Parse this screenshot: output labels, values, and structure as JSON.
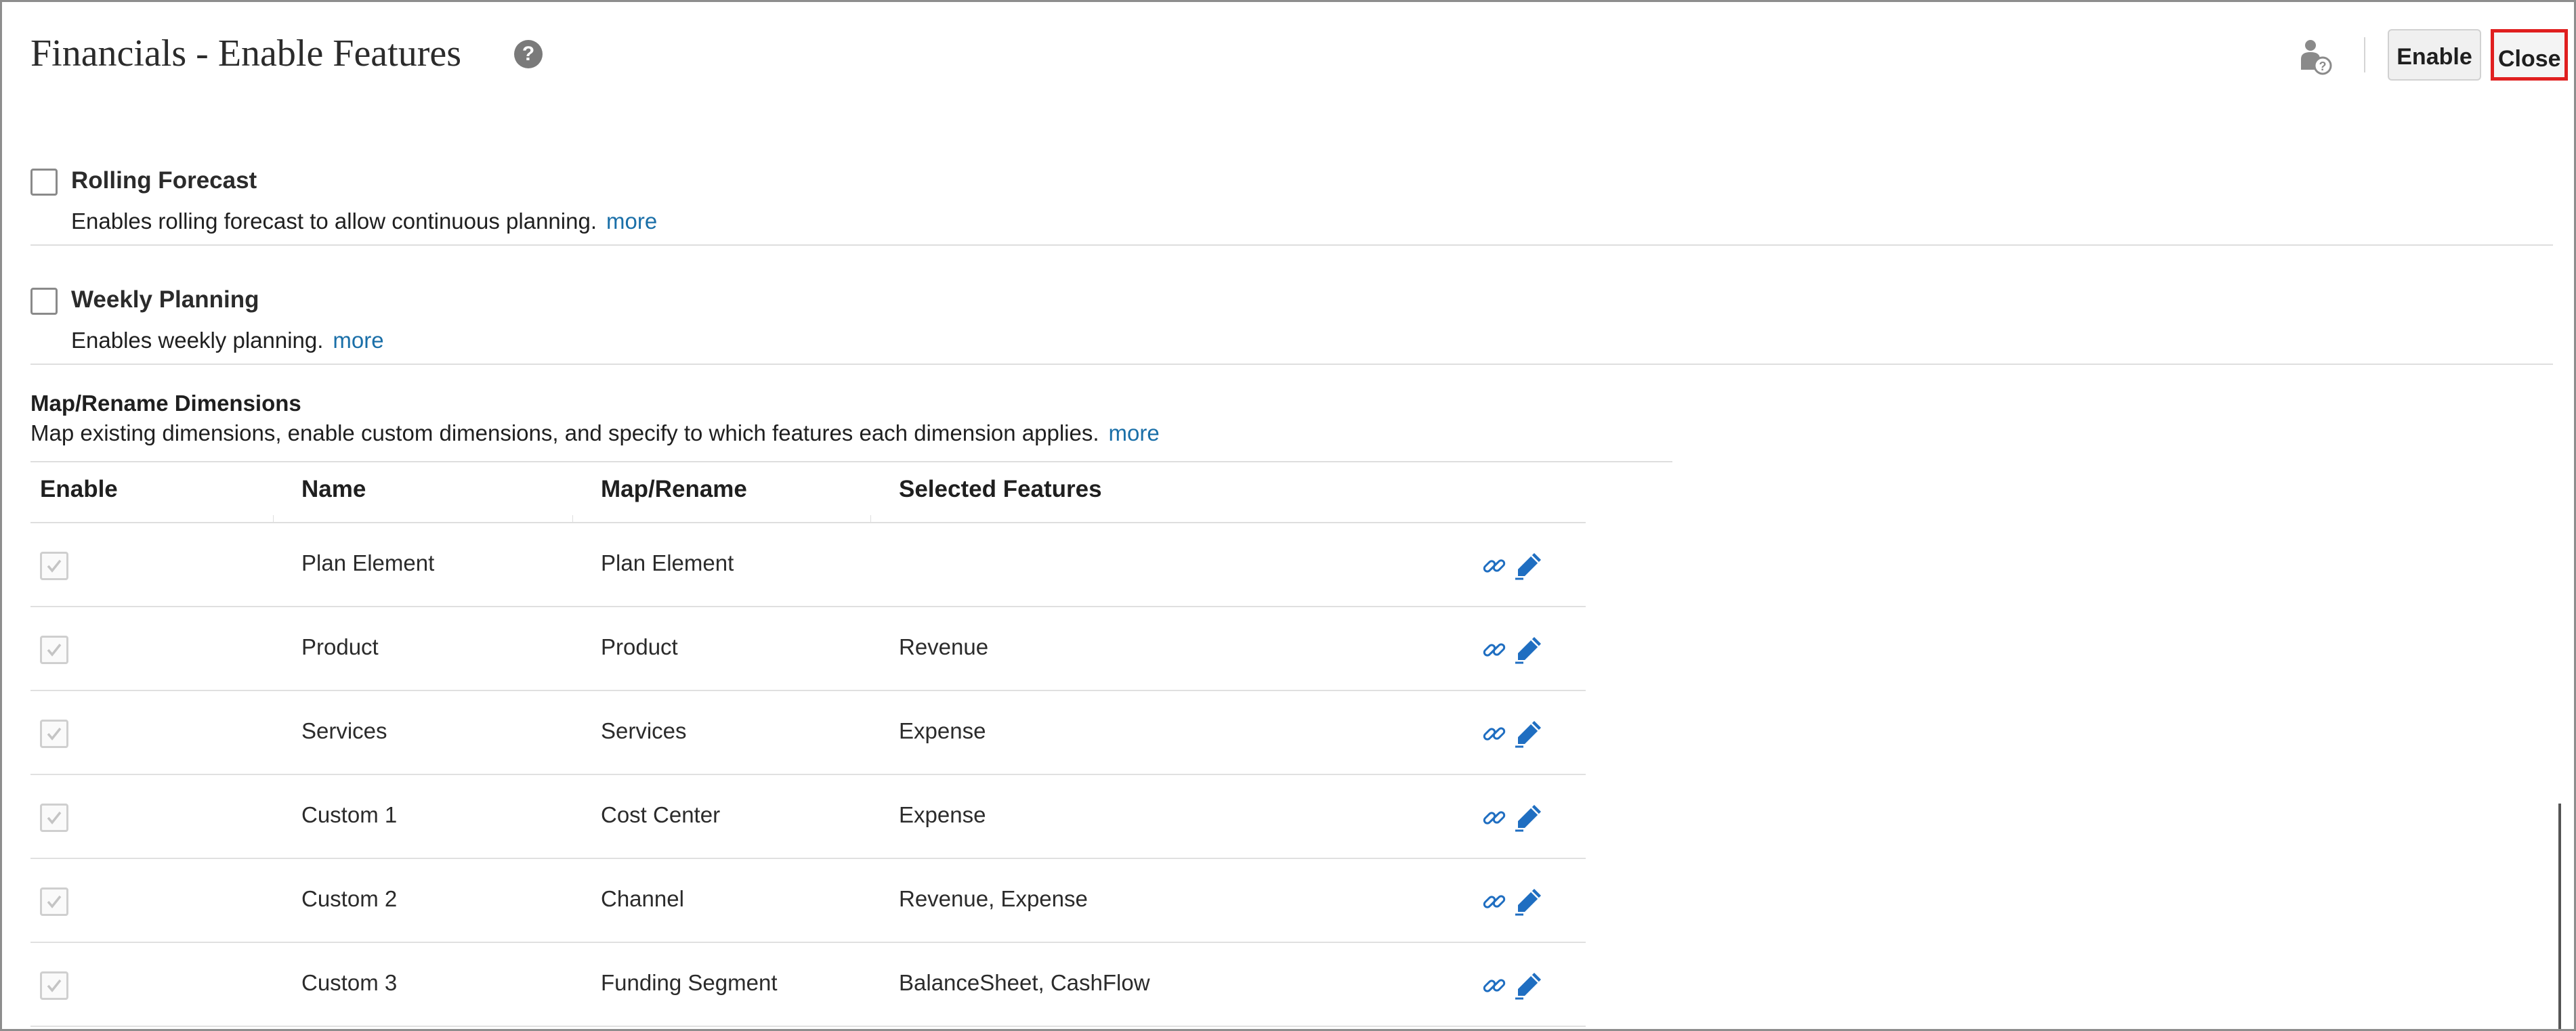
{
  "header": {
    "title": "Financials - Enable Features",
    "enable_label": "Enable",
    "close_label": "Close"
  },
  "features": [
    {
      "title": "Rolling Forecast",
      "description": "Enables rolling forecast to allow continuous planning.",
      "more": "more",
      "checked": false
    },
    {
      "title": "Weekly Planning",
      "description": "Enables weekly planning.",
      "more": "more",
      "checked": false
    }
  ],
  "dimensions": {
    "title": "Map/Rename Dimensions",
    "description": "Map existing dimensions, enable custom dimensions, and specify to which features each dimension applies.",
    "more": "more",
    "columns": [
      "Enable",
      "Name",
      "Map/Rename",
      "Selected Features"
    ],
    "rows": [
      {
        "enabled": true,
        "name": "Plan Element",
        "map": "Plan Element",
        "features": ""
      },
      {
        "enabled": true,
        "name": "Product",
        "map": "Product",
        "features": "Revenue"
      },
      {
        "enabled": true,
        "name": "Services",
        "map": "Services",
        "features": "Expense"
      },
      {
        "enabled": true,
        "name": "Custom 1",
        "map": "Cost Center",
        "features": "Expense"
      },
      {
        "enabled": true,
        "name": "Custom 2",
        "map": "Channel",
        "features": "Revenue, Expense"
      },
      {
        "enabled": true,
        "name": "Custom 3",
        "map": "Funding Segment",
        "features": "BalanceSheet, CashFlow"
      }
    ]
  },
  "icons": {
    "help": "help-question-icon",
    "user_help": "user-help-icon",
    "link": "link-icon",
    "edit": "pencil-edit-icon"
  },
  "colors": {
    "link": "#1a6fa8",
    "icon_blue": "#1f6ec1",
    "close_border": "#e01f1f"
  }
}
